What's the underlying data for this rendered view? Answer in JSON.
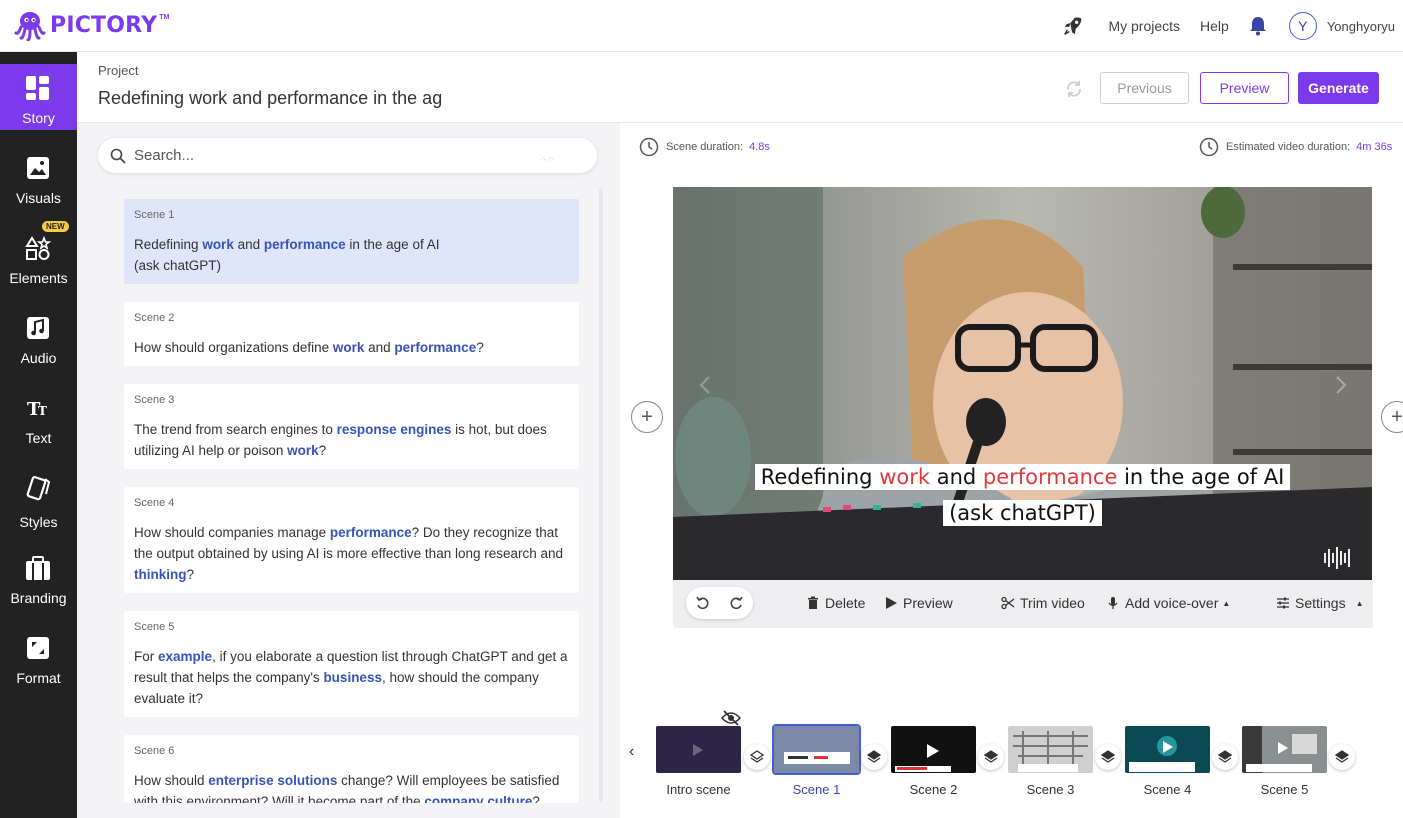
{
  "app": {
    "logo_text": "PICTORY",
    "logo_tm": "TM",
    "brand_color": "#7c3aed"
  },
  "topnav": {
    "my_projects": "My projects",
    "help": "Help",
    "avatar_initial": "Y",
    "username": "Yonghyoryu"
  },
  "sidebar": {
    "items": [
      {
        "label": "Story",
        "icon": "layout-grid-icon",
        "active": true
      },
      {
        "label": "Visuals",
        "icon": "image-icon"
      },
      {
        "label": "Elements",
        "icon": "shapes-icon",
        "badge": "NEW"
      },
      {
        "label": "Audio",
        "icon": "music-note-icon"
      },
      {
        "label": "Text",
        "icon": "text-tt-icon"
      },
      {
        "label": "Styles",
        "icon": "cards-icon"
      },
      {
        "label": "Branding",
        "icon": "briefcase-icon"
      },
      {
        "label": "Format",
        "icon": "resize-icon"
      }
    ]
  },
  "project": {
    "label": "Project",
    "title": "Redefining work and performance in the ag",
    "previous": "Previous",
    "preview": "Preview",
    "generate": "Generate"
  },
  "search": {
    "placeholder": "Search..."
  },
  "scenes": [
    {
      "num": "Scene 1"
    },
    {
      "num": "Scene 2"
    },
    {
      "num": "Scene 3"
    },
    {
      "num": "Scene 4"
    },
    {
      "num": "Scene 5"
    },
    {
      "num": "Scene 6"
    }
  ],
  "scene_texts": {
    "s1": [
      "Redefining ",
      "work",
      " and ",
      "performance",
      " in the age of AI",
      "(ask chatGPT)"
    ],
    "s2": [
      "How should organizations define ",
      "work",
      " and ",
      "performance",
      "?"
    ],
    "s3": [
      "The trend from search engines to ",
      "response engines",
      " is hot, but does utilizing AI help or poison ",
      "work",
      "?"
    ],
    "s4": [
      "How should companies manage ",
      "performance",
      "? Do they recognize that the output obtained by using AI is more effective than long research and ",
      "thinking",
      "?"
    ],
    "s5": [
      "For ",
      "example",
      ", if you elaborate a question list through ChatGPT and get a result that helps the company's ",
      "business",
      ", how should the company evaluate it?"
    ],
    "s6": [
      "How should ",
      "enterprise solutions",
      " change? Will employees be satisfied with this environment? Will it become part of the ",
      "company culture",
      "?"
    ]
  },
  "editor": {
    "scene_duration_label": "Scene duration:",
    "scene_duration_value": "4.8s",
    "estimated_label": "Estimated video duration:",
    "estimated_value": "4m 36s",
    "caption": [
      "Redefining ",
      "work",
      " and ",
      "performance",
      " in the age of AI",
      "(ask chatGPT)"
    ],
    "toolbar": {
      "delete": "Delete",
      "preview": "Preview",
      "trim": "Trim video",
      "voiceover": "Add voice-over",
      "settings": "Settings"
    }
  },
  "timeline": {
    "items": [
      "Intro scene",
      "Scene 1",
      "Scene 2",
      "Scene 3",
      "Scene 4",
      "Scene 5"
    ]
  }
}
